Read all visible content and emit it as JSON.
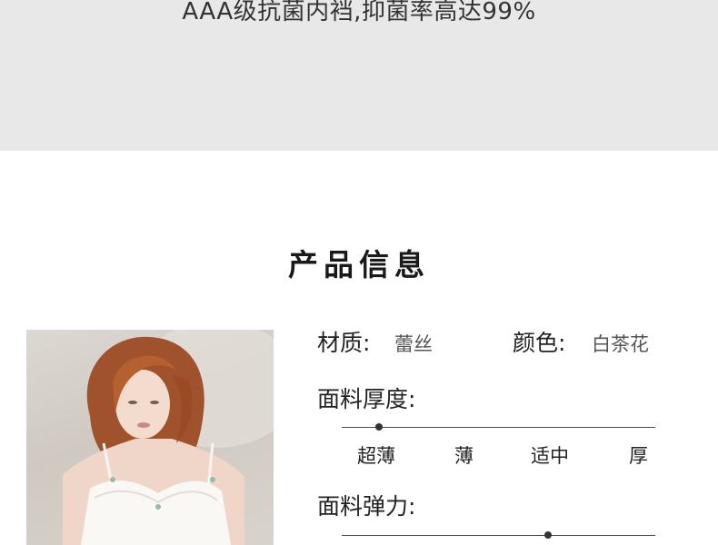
{
  "banner": {
    "text": "AAA级抗菌内裆,抑菌率高达99%"
  },
  "section": {
    "title": "产品信息"
  },
  "info": {
    "material_label": "材质:",
    "material_value": "蕾丝",
    "color_label": "颜色:",
    "color_value": "白茶花",
    "thickness_label": "面料厚度:",
    "thickness_options": [
      "超薄",
      "薄",
      "适中",
      "厚"
    ],
    "elasticity_label": "面料弹力:"
  },
  "colors": {
    "banner_bg": "#e8e8e8",
    "track": "#4a4a4a",
    "marker": "#333333"
  }
}
